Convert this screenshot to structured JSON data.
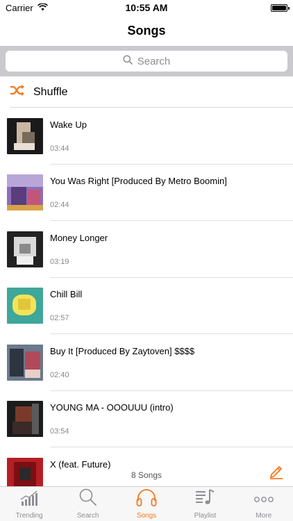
{
  "status": {
    "carrier": "Carrier",
    "time": "10:55 AM"
  },
  "nav": {
    "title": "Songs"
  },
  "search": {
    "placeholder": "Search"
  },
  "shuffle": {
    "label": "Shuffle"
  },
  "colors": {
    "accent": "#f7781c",
    "inactive": "#8e8e93"
  },
  "songs": [
    {
      "title": "Wake Up",
      "duration": "03:44"
    },
    {
      "title": "You Was Right [Produced By Metro Boomin]",
      "duration": "02:44"
    },
    {
      "title": "Money Longer",
      "duration": "03:19"
    },
    {
      "title": "Chill Bill",
      "duration": "02:57"
    },
    {
      "title": "Buy It  [Produced By Zaytoven] $$$$",
      "duration": "02:40"
    },
    {
      "title": "YOUNG MA - OOOUUU (intro)",
      "duration": "03:54"
    },
    {
      "title": "X (feat. Future)",
      "duration": ""
    }
  ],
  "footer": {
    "count": "8 Songs"
  },
  "tabs": [
    {
      "label": "Trending",
      "icon": "trending-icon"
    },
    {
      "label": "Search",
      "icon": "search-icon"
    },
    {
      "label": "Songs",
      "icon": "headphones-icon"
    },
    {
      "label": "Playlist",
      "icon": "playlist-icon"
    },
    {
      "label": "More",
      "icon": "more-icon"
    }
  ]
}
